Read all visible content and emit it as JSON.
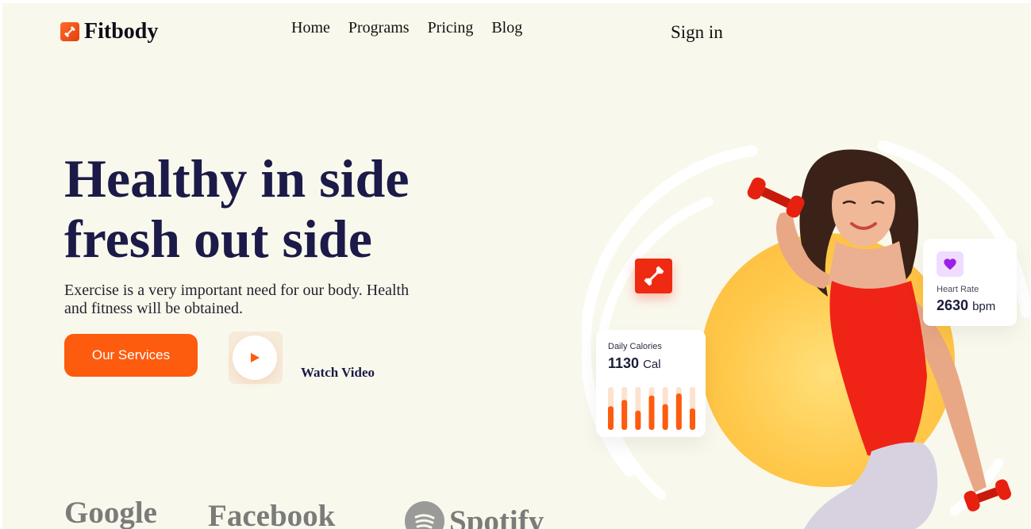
{
  "brand": {
    "name": "Fitbody",
    "icon": "dumbbell-icon",
    "color": "#fd5b0e"
  },
  "nav": {
    "items": [
      {
        "label": "Home"
      },
      {
        "label": "Programs"
      },
      {
        "label": "Pricing"
      },
      {
        "label": "Blog"
      }
    ],
    "signin": "Sign in"
  },
  "hero": {
    "title_line1": "Healthy in side",
    "title_line2": "fresh out side",
    "description": "Exercise is a very important need for our body. Health and fitness will be obtained.",
    "cta_label": "Our Services",
    "video_label": "Watch Video"
  },
  "stats": {
    "calories": {
      "label": "Daily Calories",
      "value": "1130",
      "unit": "Cal",
      "bars": [
        0.55,
        0.7,
        0.45,
        0.8,
        0.6,
        0.85,
        0.5
      ]
    },
    "heart_rate": {
      "label": "Heart Rate",
      "value": "2630",
      "unit": "bpm",
      "icon": "heart-icon"
    }
  },
  "partners": {
    "google": "Google",
    "facebook": "Facebook",
    "spotify": "Spotify"
  },
  "colors": {
    "background": "#f9f8ec",
    "heading": "#1b1a48",
    "accent": "#fd5b0e",
    "dumbbell": "#ef2a12"
  }
}
